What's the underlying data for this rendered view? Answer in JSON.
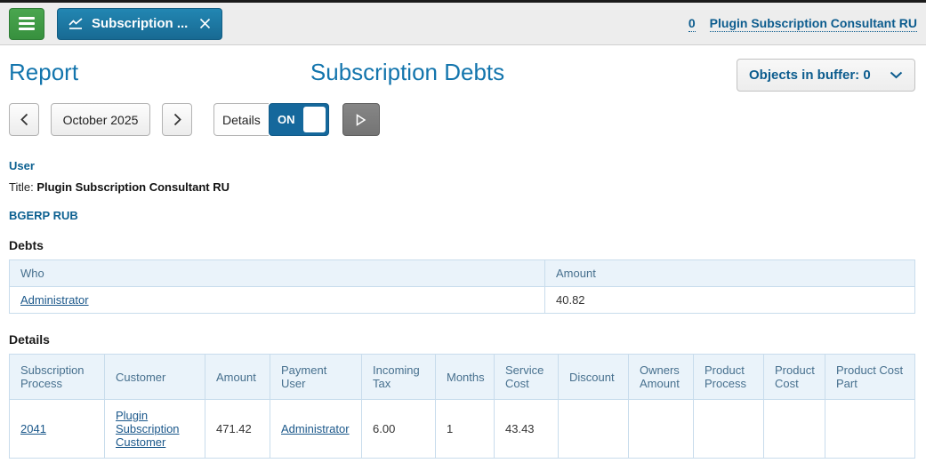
{
  "topbar": {
    "tab_label": "Subscription ...",
    "buffer_link": "0",
    "user_link": "Plugin Subscription Consultant RU"
  },
  "header": {
    "page_title": "Report",
    "report_title": "Subscription Debts",
    "buffer_button_label": "Objects in buffer: 0"
  },
  "toolbar": {
    "period": "October 2025",
    "details_label": "Details",
    "details_state": "ON"
  },
  "user_section": {
    "heading": "User",
    "title_label": "Title:",
    "title_value": "Plugin Subscription Consultant RU",
    "account": "BGERP RUB"
  },
  "debts": {
    "heading": "Debts",
    "columns": [
      "Who",
      "Amount"
    ],
    "rows": [
      {
        "who": "Administrator",
        "amount": "40.82"
      }
    ]
  },
  "details": {
    "heading": "Details",
    "columns": [
      "Subscription Process",
      "Customer",
      "Amount",
      "Payment User",
      "Incoming Tax",
      "Months",
      "Service Cost",
      "Discount",
      "Owners Amount",
      "Product Process",
      "Product Cost",
      "Product Cost Part"
    ],
    "rows": [
      {
        "subscription_process": "2041",
        "customer": "Plugin Subscription Customer",
        "amount": "471.42",
        "payment_user": "Administrator",
        "incoming_tax": "6.00",
        "months": "1",
        "service_cost": "43.43",
        "discount": "",
        "owners_amount": "",
        "product_process": "",
        "product_cost": "",
        "product_cost_part": ""
      }
    ]
  },
  "colors": {
    "accent_blue": "#1375ad",
    "tab_blue": "#1d7aa2",
    "menu_green": "#3f9c46",
    "toggle_blue": "#15689c",
    "link_blue": "#0c5c8e",
    "table_header_bg": "#eaf3fa",
    "table_border": "#c8dcec"
  }
}
